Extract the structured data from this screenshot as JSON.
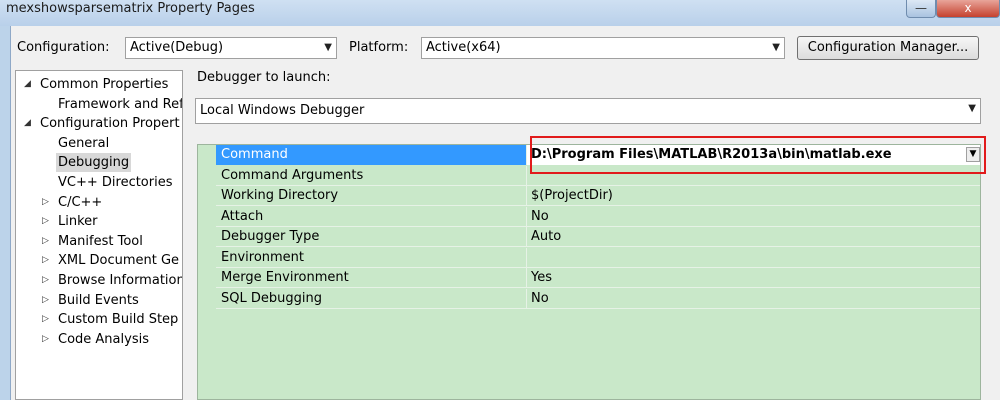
{
  "window": {
    "title": "mexshowsparsematrix Property Pages",
    "minimize_glyph": "—",
    "close_glyph": "x"
  },
  "toolbar": {
    "configuration_label": "Configuration:",
    "configuration_value": "Active(Debug)",
    "platform_label": "Platform:",
    "platform_value": "Active(x64)",
    "config_manager_label": "Configuration Manager..."
  },
  "tree": {
    "items": [
      {
        "label": "Common Properties",
        "toggle": "◢",
        "level": 0
      },
      {
        "label": "Framework and Ref",
        "toggle": "",
        "level": 1
      },
      {
        "label": "Configuration Propert",
        "toggle": "◢",
        "level": 0
      },
      {
        "label": "General",
        "toggle": "",
        "level": 1
      },
      {
        "label": "Debugging",
        "toggle": "",
        "level": 1,
        "selected": true
      },
      {
        "label": "VC++ Directories",
        "toggle": "",
        "level": 1
      },
      {
        "label": "C/C++",
        "toggle": "▷",
        "level": 1
      },
      {
        "label": "Linker",
        "toggle": "▷",
        "level": 1
      },
      {
        "label": "Manifest Tool",
        "toggle": "▷",
        "level": 1
      },
      {
        "label": "XML Document Ge",
        "toggle": "▷",
        "level": 1
      },
      {
        "label": "Browse Information",
        "toggle": "▷",
        "level": 1
      },
      {
        "label": "Build Events",
        "toggle": "▷",
        "level": 1
      },
      {
        "label": "Custom Build Step",
        "toggle": "▷",
        "level": 1
      },
      {
        "label": "Code Analysis",
        "toggle": "▷",
        "level": 1
      }
    ]
  },
  "debugger": {
    "launch_label": "Debugger to launch:",
    "launch_value": "Local Windows Debugger"
  },
  "properties": {
    "rows": [
      {
        "name": "Command",
        "value": "D:\\Program Files\\MATLAB\\R2013a\\bin\\matlab.exe",
        "selected": true
      },
      {
        "name": "Command Arguments",
        "value": ""
      },
      {
        "name": "Working Directory",
        "value": "$(ProjectDir)"
      },
      {
        "name": "Attach",
        "value": "No"
      },
      {
        "name": "Debugger Type",
        "value": "Auto"
      },
      {
        "name": "Environment",
        "value": ""
      },
      {
        "name": "Merge Environment",
        "value": "Yes"
      },
      {
        "name": "SQL Debugging",
        "value": "No"
      }
    ]
  },
  "icons": {
    "dropdown": "▼"
  },
  "colors": {
    "grid_bg": "#c9e8c9",
    "selection": "#3399ff",
    "highlight": "#e11b1b"
  }
}
